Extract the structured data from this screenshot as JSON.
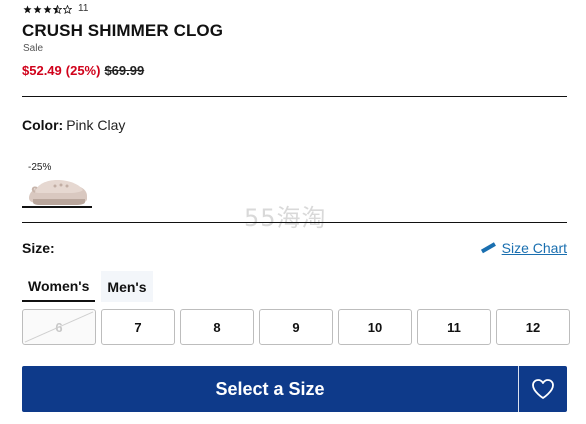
{
  "product": {
    "rating_value": 3.5,
    "rating_max": 5,
    "rating_count": "11",
    "title": "CRUSH SHIMMER CLOG",
    "sale_label": "Sale",
    "price_sale": "$52.49",
    "price_discount": "(25%)",
    "price_original": "$69.99"
  },
  "color": {
    "label": "Color:",
    "value": "Pink Clay",
    "swatch_badge": "-25%"
  },
  "watermark": "55海淘",
  "size": {
    "label": "Size:",
    "chart_link": "Size Chart",
    "tabs": [
      {
        "label": "Women's",
        "active": true
      },
      {
        "label": "Men's",
        "active": false
      }
    ],
    "options": [
      {
        "label": "6",
        "available": false
      },
      {
        "label": "7",
        "available": true
      },
      {
        "label": "8",
        "available": true
      },
      {
        "label": "9",
        "available": true
      },
      {
        "label": "10",
        "available": true
      },
      {
        "label": "11",
        "available": true
      },
      {
        "label": "12",
        "available": true
      }
    ]
  },
  "cta": {
    "label": "Select a Size"
  },
  "colors": {
    "sale_red": "#d0021b",
    "cta_blue": "#0e3a8a",
    "link_blue": "#1a6fb0"
  }
}
